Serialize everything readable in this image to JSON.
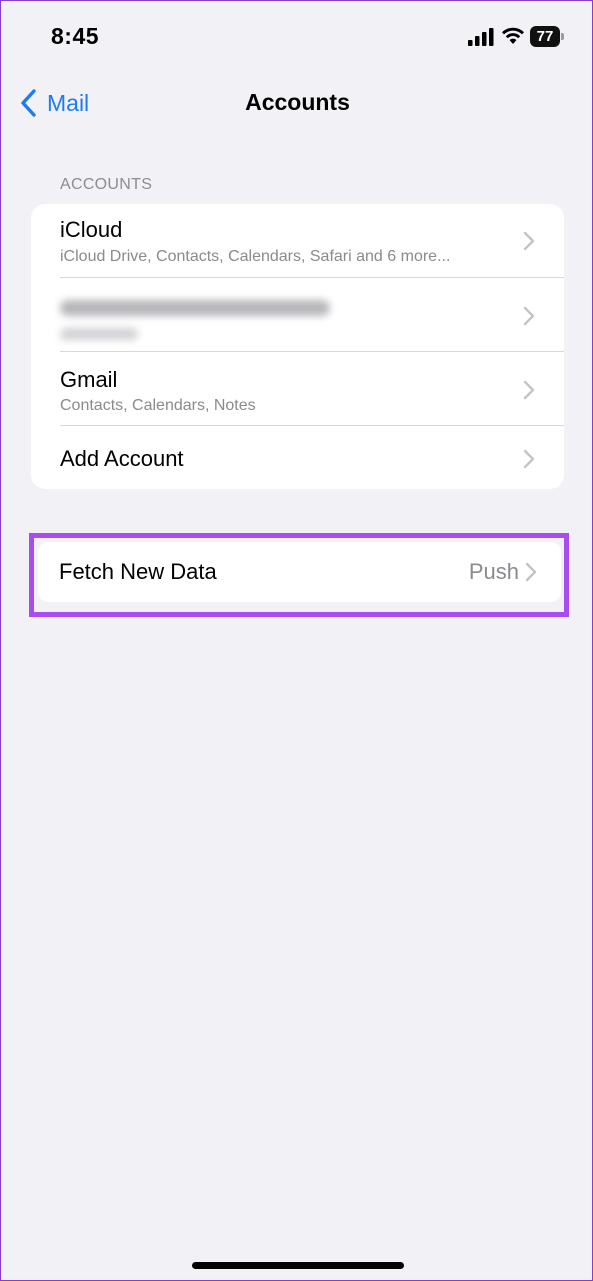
{
  "status": {
    "time": "8:45",
    "battery": "77"
  },
  "nav": {
    "back_label": "Mail",
    "title": "Accounts"
  },
  "accounts_section": {
    "header": "ACCOUNTS",
    "items": [
      {
        "title": "iCloud",
        "subtitle": "iCloud Drive, Contacts, Calendars, Safari and 6 more..."
      },
      {
        "title": "",
        "subtitle": ""
      },
      {
        "title": "Gmail",
        "subtitle": "Contacts, Calendars, Notes"
      },
      {
        "title": "Add Account",
        "subtitle": ""
      }
    ]
  },
  "fetch": {
    "label": "Fetch New Data",
    "value": "Push"
  },
  "colors": {
    "accent": "#1a7cf5",
    "highlight": "#a84ef0",
    "background": "#f2f1f6"
  }
}
